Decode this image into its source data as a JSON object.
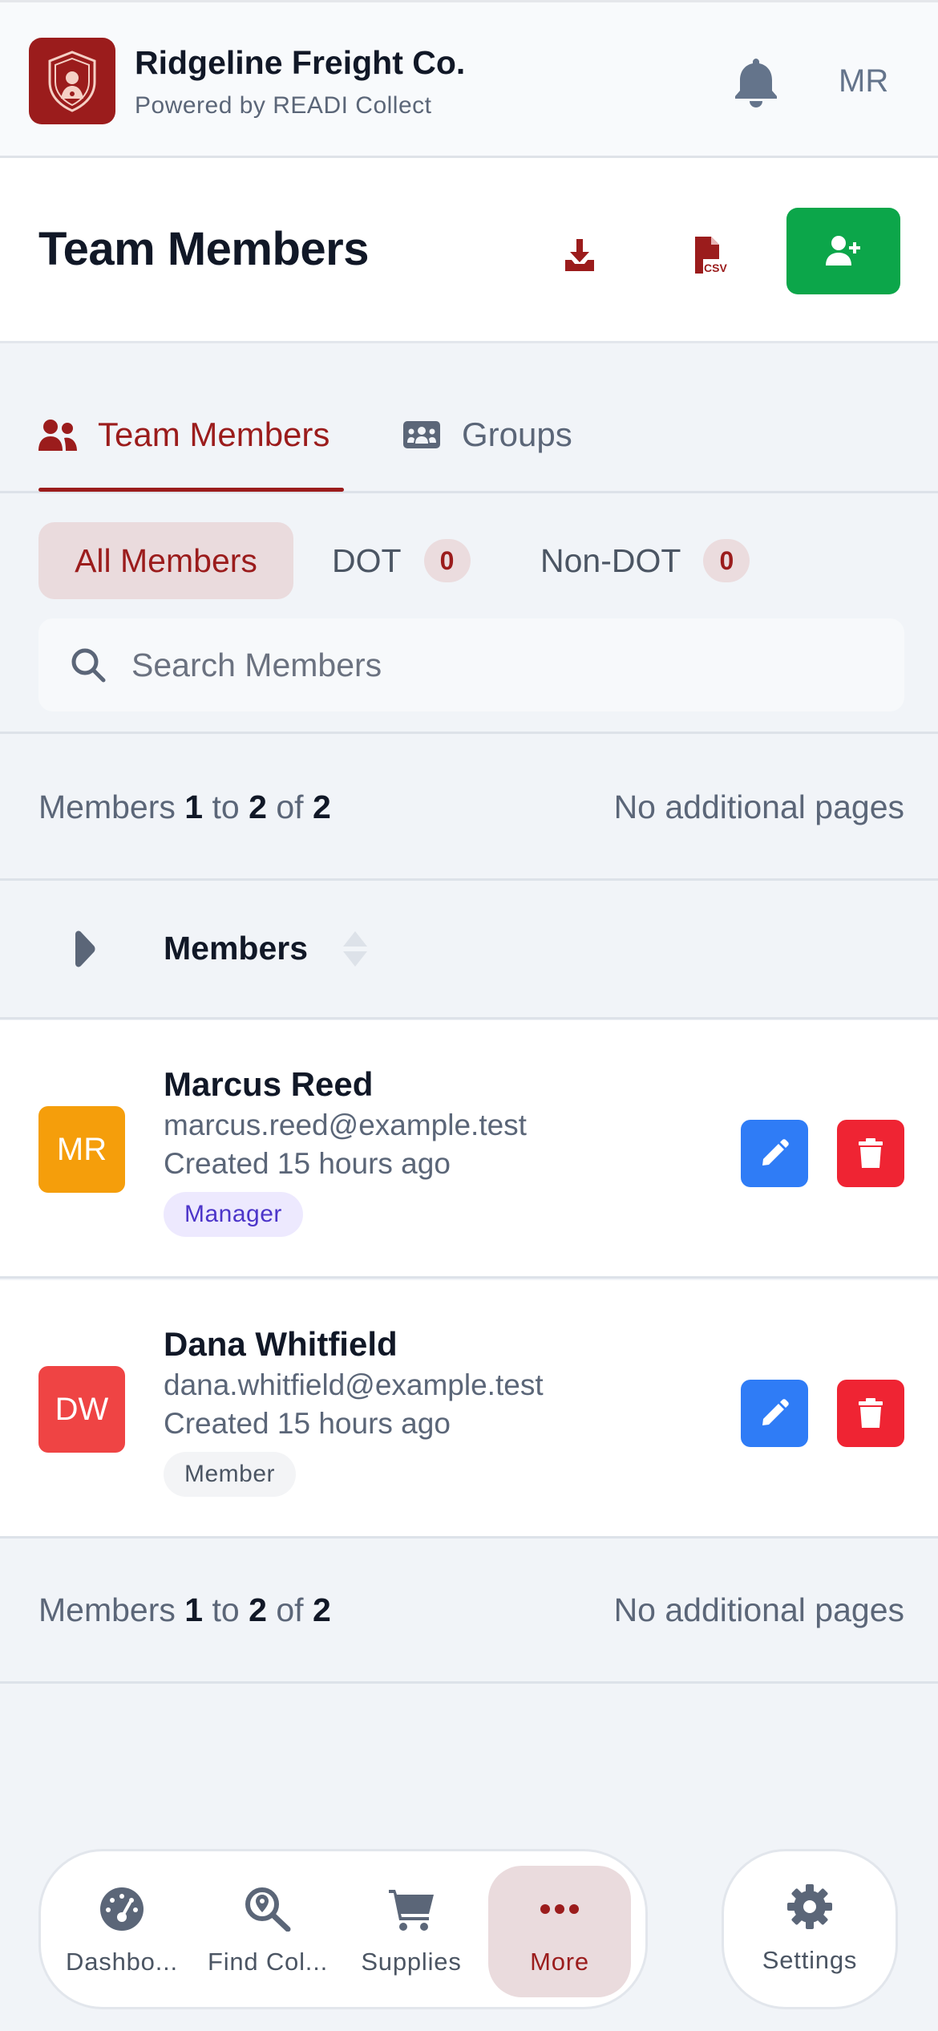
{
  "header": {
    "company_name": "Ridgeline Freight Co.",
    "powered_by": "Powered by READI Collect",
    "user_initials": "MR"
  },
  "title_bar": {
    "title": "Team Members",
    "download_icon": "download-icon",
    "csv_icon": "csv-file-icon",
    "add_icon": "user-plus-icon"
  },
  "tabs": [
    {
      "label": "Team Members",
      "icon": "users-icon",
      "active": true
    },
    {
      "label": "Groups",
      "icon": "groups-icon",
      "active": false
    }
  ],
  "filters": {
    "all": {
      "label": "All Members"
    },
    "dot": {
      "label": "DOT",
      "count": "0"
    },
    "non_dot": {
      "label": "Non-DOT",
      "count": "0"
    }
  },
  "search": {
    "placeholder": "Search Members"
  },
  "pagination": {
    "prefix": "Members",
    "from": "1",
    "to_word": "to",
    "to": "2",
    "of_word": "of",
    "total": "2",
    "pages_text": "No additional pages"
  },
  "table": {
    "column_label": "Members"
  },
  "members": [
    {
      "initials": "MR",
      "name": "Marcus Reed",
      "email": "marcus.reed@example.test",
      "created": "Created 15 hours ago",
      "role": "Manager",
      "avatar_color": "#f59e0b"
    },
    {
      "initials": "DW",
      "name": "Dana Whitfield",
      "email": "dana.whitfield@example.test",
      "created": "Created 15 hours ago",
      "role": "Member",
      "avatar_color": "#ef4444"
    }
  ],
  "bottom_nav": {
    "items": [
      {
        "label": "Dashbo...",
        "icon": "dashboard-gauge-icon"
      },
      {
        "label": "Find Col...",
        "icon": "map-search-icon"
      },
      {
        "label": "Supplies",
        "icon": "cart-icon"
      },
      {
        "label": "More",
        "icon": "more-dots-icon",
        "active": true
      }
    ],
    "settings": {
      "label": "Settings",
      "icon": "gear-icon"
    }
  },
  "colors": {
    "brand": "#9b1c1c",
    "add_button": "#0ca64a",
    "edit_button": "#2f7cf6",
    "delete_button": "#ef2433"
  }
}
